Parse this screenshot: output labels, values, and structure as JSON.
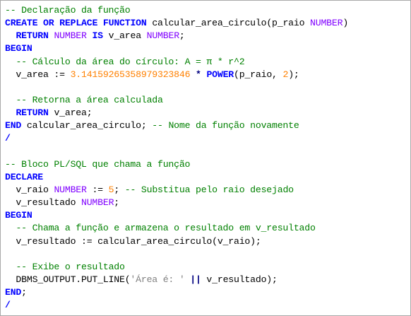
{
  "editor": {
    "lines": [
      [
        [
          "cm",
          "-- Declaração da função"
        ]
      ],
      [
        [
          "kw",
          "CREATE"
        ],
        [
          "id",
          " "
        ],
        [
          "kw",
          "OR"
        ],
        [
          "id",
          " "
        ],
        [
          "kw",
          "REPLACE"
        ],
        [
          "id",
          " "
        ],
        [
          "kw",
          "FUNCTION"
        ],
        [
          "id",
          " calcular_area_circulo(p_raio "
        ],
        [
          "ty",
          "NUMBER"
        ],
        [
          "id",
          ")"
        ]
      ],
      [
        [
          "id",
          "  "
        ],
        [
          "kw",
          "RETURN"
        ],
        [
          "id",
          " "
        ],
        [
          "ty",
          "NUMBER"
        ],
        [
          "id",
          " "
        ],
        [
          "kw",
          "IS"
        ],
        [
          "id",
          " v_area "
        ],
        [
          "ty",
          "NUMBER"
        ],
        [
          "id",
          ";"
        ]
      ],
      [
        [
          "kw",
          "BEGIN"
        ]
      ],
      [
        [
          "id",
          "  "
        ],
        [
          "cm",
          "-- Cálculo da área do círculo: A = π * r^2"
        ]
      ],
      [
        [
          "id",
          "  v_area := "
        ],
        [
          "num",
          "3.14159265358979323846"
        ],
        [
          "id",
          " "
        ],
        [
          "op",
          "*"
        ],
        [
          "id",
          " "
        ],
        [
          "kw",
          "POWER"
        ],
        [
          "id",
          "(p_raio, "
        ],
        [
          "num",
          "2"
        ],
        [
          "id",
          ");"
        ]
      ],
      [],
      [
        [
          "id",
          "  "
        ],
        [
          "cm",
          "-- Retorna a área calculada"
        ]
      ],
      [
        [
          "id",
          "  "
        ],
        [
          "kw",
          "RETURN"
        ],
        [
          "id",
          " v_area;"
        ]
      ],
      [
        [
          "kw",
          "END"
        ],
        [
          "id",
          " calcular_area_circulo; "
        ],
        [
          "cm",
          "-- Nome da função novamente"
        ]
      ],
      [
        [
          "kw",
          "/"
        ]
      ],
      [],
      [
        [
          "cm",
          "-- Bloco PL/SQL que chama a função"
        ]
      ],
      [
        [
          "kw",
          "DECLARE"
        ]
      ],
      [
        [
          "id",
          "  v_raio "
        ],
        [
          "ty",
          "NUMBER"
        ],
        [
          "id",
          " := "
        ],
        [
          "num",
          "5"
        ],
        [
          "id",
          "; "
        ],
        [
          "cm",
          "-- Substitua pelo raio desejado"
        ]
      ],
      [
        [
          "id",
          "  v_resultado "
        ],
        [
          "ty",
          "NUMBER"
        ],
        [
          "id",
          ";"
        ]
      ],
      [
        [
          "kw",
          "BEGIN"
        ]
      ],
      [
        [
          "id",
          "  "
        ],
        [
          "cm",
          "-- Chama a função e armazena o resultado em v_resultado"
        ]
      ],
      [
        [
          "id",
          "  v_resultado := calcular_area_circulo(v_raio);"
        ]
      ],
      [],
      [
        [
          "id",
          "  "
        ],
        [
          "cm",
          "-- Exibe o resultado"
        ]
      ],
      [
        [
          "id",
          "  DBMS_OUTPUT.PUT_LINE("
        ],
        [
          "str",
          "'Área é: '"
        ],
        [
          "id",
          " "
        ],
        [
          "op",
          "||"
        ],
        [
          "id",
          " v_resultado);"
        ]
      ],
      [
        [
          "kw",
          "END"
        ],
        [
          "id",
          ";"
        ]
      ],
      [
        [
          "kw",
          "/"
        ]
      ]
    ]
  }
}
